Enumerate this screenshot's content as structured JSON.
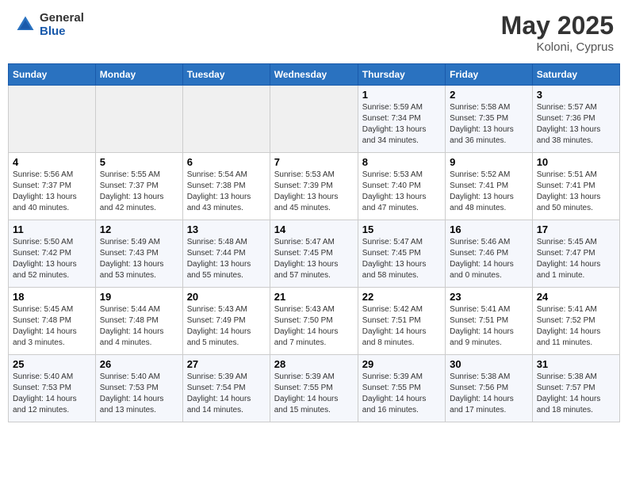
{
  "header": {
    "logo_general": "General",
    "logo_blue": "Blue",
    "month_year": "May 2025",
    "location": "Koloni, Cyprus"
  },
  "days_of_week": [
    "Sunday",
    "Monday",
    "Tuesday",
    "Wednesday",
    "Thursday",
    "Friday",
    "Saturday"
  ],
  "weeks": [
    [
      {
        "day": "",
        "info": ""
      },
      {
        "day": "",
        "info": ""
      },
      {
        "day": "",
        "info": ""
      },
      {
        "day": "",
        "info": ""
      },
      {
        "day": "1",
        "info": "Sunrise: 5:59 AM\nSunset: 7:34 PM\nDaylight: 13 hours\nand 34 minutes."
      },
      {
        "day": "2",
        "info": "Sunrise: 5:58 AM\nSunset: 7:35 PM\nDaylight: 13 hours\nand 36 minutes."
      },
      {
        "day": "3",
        "info": "Sunrise: 5:57 AM\nSunset: 7:36 PM\nDaylight: 13 hours\nand 38 minutes."
      }
    ],
    [
      {
        "day": "4",
        "info": "Sunrise: 5:56 AM\nSunset: 7:37 PM\nDaylight: 13 hours\nand 40 minutes."
      },
      {
        "day": "5",
        "info": "Sunrise: 5:55 AM\nSunset: 7:37 PM\nDaylight: 13 hours\nand 42 minutes."
      },
      {
        "day": "6",
        "info": "Sunrise: 5:54 AM\nSunset: 7:38 PM\nDaylight: 13 hours\nand 43 minutes."
      },
      {
        "day": "7",
        "info": "Sunrise: 5:53 AM\nSunset: 7:39 PM\nDaylight: 13 hours\nand 45 minutes."
      },
      {
        "day": "8",
        "info": "Sunrise: 5:53 AM\nSunset: 7:40 PM\nDaylight: 13 hours\nand 47 minutes."
      },
      {
        "day": "9",
        "info": "Sunrise: 5:52 AM\nSunset: 7:41 PM\nDaylight: 13 hours\nand 48 minutes."
      },
      {
        "day": "10",
        "info": "Sunrise: 5:51 AM\nSunset: 7:41 PM\nDaylight: 13 hours\nand 50 minutes."
      }
    ],
    [
      {
        "day": "11",
        "info": "Sunrise: 5:50 AM\nSunset: 7:42 PM\nDaylight: 13 hours\nand 52 minutes."
      },
      {
        "day": "12",
        "info": "Sunrise: 5:49 AM\nSunset: 7:43 PM\nDaylight: 13 hours\nand 53 minutes."
      },
      {
        "day": "13",
        "info": "Sunrise: 5:48 AM\nSunset: 7:44 PM\nDaylight: 13 hours\nand 55 minutes."
      },
      {
        "day": "14",
        "info": "Sunrise: 5:47 AM\nSunset: 7:45 PM\nDaylight: 13 hours\nand 57 minutes."
      },
      {
        "day": "15",
        "info": "Sunrise: 5:47 AM\nSunset: 7:45 PM\nDaylight: 13 hours\nand 58 minutes."
      },
      {
        "day": "16",
        "info": "Sunrise: 5:46 AM\nSunset: 7:46 PM\nDaylight: 14 hours\nand 0 minutes."
      },
      {
        "day": "17",
        "info": "Sunrise: 5:45 AM\nSunset: 7:47 PM\nDaylight: 14 hours\nand 1 minute."
      }
    ],
    [
      {
        "day": "18",
        "info": "Sunrise: 5:45 AM\nSunset: 7:48 PM\nDaylight: 14 hours\nand 3 minutes."
      },
      {
        "day": "19",
        "info": "Sunrise: 5:44 AM\nSunset: 7:48 PM\nDaylight: 14 hours\nand 4 minutes."
      },
      {
        "day": "20",
        "info": "Sunrise: 5:43 AM\nSunset: 7:49 PM\nDaylight: 14 hours\nand 5 minutes."
      },
      {
        "day": "21",
        "info": "Sunrise: 5:43 AM\nSunset: 7:50 PM\nDaylight: 14 hours\nand 7 minutes."
      },
      {
        "day": "22",
        "info": "Sunrise: 5:42 AM\nSunset: 7:51 PM\nDaylight: 14 hours\nand 8 minutes."
      },
      {
        "day": "23",
        "info": "Sunrise: 5:41 AM\nSunset: 7:51 PM\nDaylight: 14 hours\nand 9 minutes."
      },
      {
        "day": "24",
        "info": "Sunrise: 5:41 AM\nSunset: 7:52 PM\nDaylight: 14 hours\nand 11 minutes."
      }
    ],
    [
      {
        "day": "25",
        "info": "Sunrise: 5:40 AM\nSunset: 7:53 PM\nDaylight: 14 hours\nand 12 minutes."
      },
      {
        "day": "26",
        "info": "Sunrise: 5:40 AM\nSunset: 7:53 PM\nDaylight: 14 hours\nand 13 minutes."
      },
      {
        "day": "27",
        "info": "Sunrise: 5:39 AM\nSunset: 7:54 PM\nDaylight: 14 hours\nand 14 minutes."
      },
      {
        "day": "28",
        "info": "Sunrise: 5:39 AM\nSunset: 7:55 PM\nDaylight: 14 hours\nand 15 minutes."
      },
      {
        "day": "29",
        "info": "Sunrise: 5:39 AM\nSunset: 7:55 PM\nDaylight: 14 hours\nand 16 minutes."
      },
      {
        "day": "30",
        "info": "Sunrise: 5:38 AM\nSunset: 7:56 PM\nDaylight: 14 hours\nand 17 minutes."
      },
      {
        "day": "31",
        "info": "Sunrise: 5:38 AM\nSunset: 7:57 PM\nDaylight: 14 hours\nand 18 minutes."
      }
    ]
  ]
}
